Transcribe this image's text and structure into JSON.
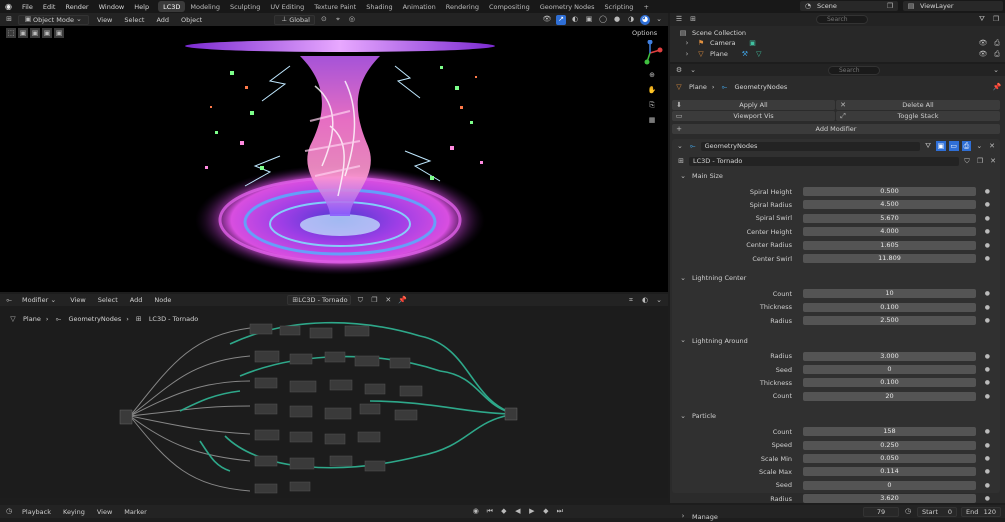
{
  "topbar": {
    "menus": [
      "File",
      "Edit",
      "Render",
      "Window",
      "Help"
    ],
    "workspaces": [
      "LC3D",
      "Modeling",
      "Sculpting",
      "UV Editing",
      "Texture Paint",
      "Shading",
      "Animation",
      "Rendering",
      "Compositing",
      "Geometry Nodes",
      "Scripting"
    ],
    "active_workspace": "LC3D",
    "scene": "Scene",
    "view_layer": "ViewLayer"
  },
  "viewport": {
    "mode": "Object Mode",
    "menus": [
      "View",
      "Select",
      "Add",
      "Object"
    ],
    "transform": "Global",
    "options": "Options"
  },
  "outliner": {
    "search_placeholder": "Search",
    "collection": "Scene Collection",
    "items": [
      {
        "name": "Camera"
      },
      {
        "name": "Plane"
      }
    ]
  },
  "properties": {
    "search_placeholder": "Search",
    "breadcrumb": {
      "object": "Plane",
      "modifier": "GeometryNodes"
    },
    "apply_all": "Apply All",
    "delete_all": "Delete All",
    "viewport_vis": "Viewport Vis",
    "toggle_stack": "Toggle Stack",
    "add_modifier": "Add Modifier",
    "modifier_name": "GeometryNodes",
    "node_group": "LC3D - Tornado",
    "sections": [
      {
        "title": "Main Size",
        "rows": [
          {
            "label": "Spiral Height",
            "value": "0.500"
          },
          {
            "label": "Spiral Radius",
            "value": "4.500"
          },
          {
            "label": "Spiral Swirl",
            "value": "5.670"
          },
          {
            "label": "Center Height",
            "value": "4.000"
          },
          {
            "label": "Center Radius",
            "value": "1.605"
          },
          {
            "label": "Center Swirl",
            "value": "11.809"
          }
        ]
      },
      {
        "title": "Lightning Center",
        "rows": [
          {
            "label": "Count",
            "value": "10"
          },
          {
            "label": "Thickness",
            "value": "0.100"
          },
          {
            "label": "Radius",
            "value": "2.500"
          }
        ]
      },
      {
        "title": "Lightning Around",
        "rows": [
          {
            "label": "Radius",
            "value": "3.000"
          },
          {
            "label": "Seed",
            "value": "0"
          },
          {
            "label": "Thickness",
            "value": "0.100"
          },
          {
            "label": "Count",
            "value": "20"
          }
        ]
      },
      {
        "title": "Particle",
        "rows": [
          {
            "label": "Count",
            "value": "158"
          },
          {
            "label": "Speed",
            "value": "0.250"
          },
          {
            "label": "Scale Min",
            "value": "0.050"
          },
          {
            "label": "Scale Max",
            "value": "0.114"
          },
          {
            "label": "Seed",
            "value": "0"
          },
          {
            "label": "Radius",
            "value": "3.620"
          }
        ]
      }
    ],
    "manage": "Manage"
  },
  "node_editor": {
    "editor_type": "Modifier",
    "menus": [
      "View",
      "Select",
      "Add",
      "Node"
    ],
    "node_group": "LC3D - Tornado",
    "breadcrumb": [
      "Plane",
      "GeometryNodes",
      "LC3D - Tornado"
    ]
  },
  "timeline": {
    "menus": [
      "Playback",
      "Keying",
      "View",
      "Marker"
    ],
    "current_frame": "79",
    "start_label": "Start",
    "start": "0",
    "end_label": "End",
    "end": "120"
  },
  "colors": {
    "accent": "#2f6fd6",
    "node_link": "#2ea88a",
    "panel": "#2b2b2b"
  }
}
